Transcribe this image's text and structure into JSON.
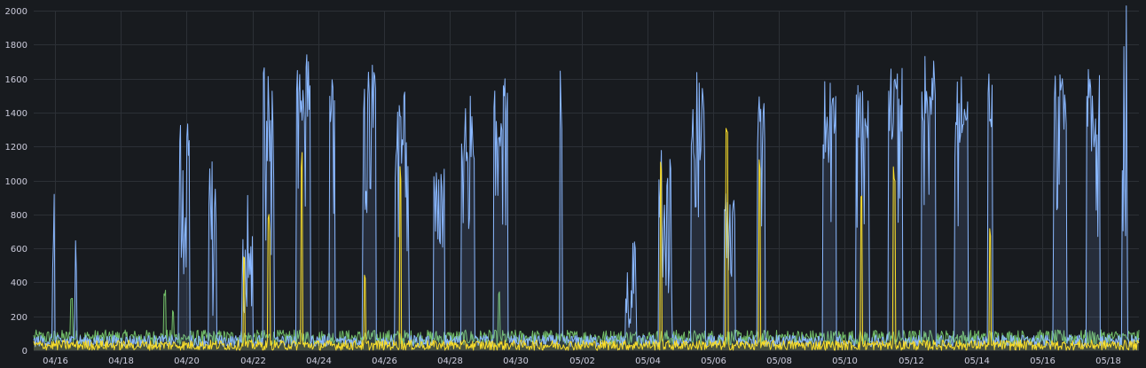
{
  "chart_data": {
    "type": "area",
    "grid": true,
    "legend": "none",
    "ylim": [
      0,
      2000
    ],
    "y_ticks": [
      "0",
      "200",
      "400",
      "600",
      "800",
      "1000",
      "1200",
      "1400",
      "1600",
      "1800",
      "2000"
    ],
    "x_ticks": [
      "04/16",
      "04/18",
      "04/20",
      "04/22",
      "04/24",
      "04/26",
      "04/28",
      "04/30",
      "05/02",
      "05/04",
      "05/06",
      "05/08",
      "05/10",
      "05/12",
      "05/14",
      "05/16",
      "05/18"
    ],
    "x_range_days": [
      0,
      34
    ],
    "colors": {
      "blue": "#8ab8ff",
      "yellow": "#fade2a",
      "green": "#73bf69",
      "grid": "#2c3036",
      "text": "#ccccdc",
      "background": "#181b1f"
    },
    "series": [
      {
        "color": "#8ab8ff",
        "baseline": [
          20,
          90
        ],
        "bursts": [
          {
            "start": "04/15 22:00",
            "end": "04/16 00:00",
            "level": [
              400,
              1160
            ]
          },
          {
            "start": "04/16 14:00",
            "end": "04/16 16:00",
            "level": [
              300,
              1500
            ]
          },
          {
            "start": "04/19 18:00",
            "end": "04/20 02:00",
            "level": [
              600,
              1360
            ]
          },
          {
            "start": "04/20 16:00",
            "end": "04/20 22:00",
            "level": [
              100,
              1140
            ]
          },
          {
            "start": "04/21 16:00",
            "end": "04/22 00:00",
            "level": [
              200,
              1000
            ]
          },
          {
            "start": "04/22 08:00",
            "end": "04/22 16:00",
            "level": [
              900,
              1680
            ]
          },
          {
            "start": "04/23 08:00",
            "end": "04/23 18:00",
            "level": [
              1300,
              1750
            ]
          },
          {
            "start": "04/24 08:00",
            "end": "04/24 12:00",
            "level": [
              1200,
              1640
            ]
          },
          {
            "start": "04/25 08:00",
            "end": "04/25 18:00",
            "level": [
              1300,
              1740
            ]
          },
          {
            "start": "04/26 08:00",
            "end": "04/26 18:00",
            "level": [
              900,
              1530
            ]
          },
          {
            "start": "04/27 12:00",
            "end": "04/27 20:00",
            "level": [
              600,
              1090
            ]
          },
          {
            "start": "04/28 08:00",
            "end": "04/28 18:00",
            "level": [
              1100,
              1510
            ]
          },
          {
            "start": "04/29 08:00",
            "end": "04/29 18:00",
            "level": [
              1200,
              1610
            ]
          },
          {
            "start": "05/01 08:00",
            "end": "05/01 10:00",
            "level": [
              400,
              1650
            ]
          },
          {
            "start": "05/03 08:00",
            "end": "05/03 16:00",
            "level": [
              100,
              650
            ]
          },
          {
            "start": "05/04 08:00",
            "end": "05/04 18:00",
            "level": [
              400,
              1280
            ]
          },
          {
            "start": "05/05 08:00",
            "end": "05/05 18:00",
            "level": [
              1100,
              1690
            ]
          },
          {
            "start": "05/06 08:00",
            "end": "05/06 16:00",
            "level": [
              500,
              1060
            ]
          },
          {
            "start": "05/07 08:00",
            "end": "05/07 14:00",
            "level": [
              1200,
              1700
            ]
          },
          {
            "start": "05/09 08:00",
            "end": "05/09 18:00",
            "level": [
              1100,
              1620
            ]
          },
          {
            "start": "05/10 08:00",
            "end": "05/10 18:00",
            "level": [
              1200,
              1620
            ]
          },
          {
            "start": "05/11 08:00",
            "end": "05/11 18:00",
            "level": [
              1200,
              1680
            ]
          },
          {
            "start": "05/12 08:00",
            "end": "05/12 18:00",
            "level": [
              1300,
              1760
            ]
          },
          {
            "start": "05/13 08:00",
            "end": "05/13 18:00",
            "level": [
              1100,
              1640
            ]
          },
          {
            "start": "05/14 08:00",
            "end": "05/14 12:00",
            "level": [
              1300,
              1650
            ]
          },
          {
            "start": "05/16 08:00",
            "end": "05/16 18:00",
            "level": [
              1300,
              1670
            ]
          },
          {
            "start": "05/17 08:00",
            "end": "05/17 18:00",
            "level": [
              1100,
              1700
            ]
          },
          {
            "start": "05/18 10:00",
            "end": "05/18 14:00",
            "level": [
              600,
              2060
            ]
          }
        ]
      },
      {
        "color": "#fade2a",
        "baseline": [
          0,
          60
        ],
        "spikes": [
          {
            "at": "04/21 18:00",
            "value": 560
          },
          {
            "at": "04/22 12:00",
            "value": 820
          },
          {
            "at": "04/23 12:00",
            "value": 1250
          },
          {
            "at": "04/25 10:00",
            "value": 450
          },
          {
            "at": "04/26 12:00",
            "value": 1100
          },
          {
            "at": "05/04 10:00",
            "value": 1200
          },
          {
            "at": "05/06 10:00",
            "value": 1340
          },
          {
            "at": "05/07 10:00",
            "value": 1150
          },
          {
            "at": "05/10 12:00",
            "value": 1000
          },
          {
            "at": "05/11 12:00",
            "value": 1160
          },
          {
            "at": "05/14 10:00",
            "value": 720
          }
        ]
      },
      {
        "color": "#73bf69",
        "baseline": [
          30,
          120
        ],
        "spikes": [
          {
            "at": "04/16 12:00",
            "value": 320
          },
          {
            "at": "04/19 08:00",
            "value": 360
          },
          {
            "at": "04/19 14:00",
            "value": 240
          },
          {
            "at": "04/29 12:00",
            "value": 350
          }
        ]
      }
    ]
  }
}
